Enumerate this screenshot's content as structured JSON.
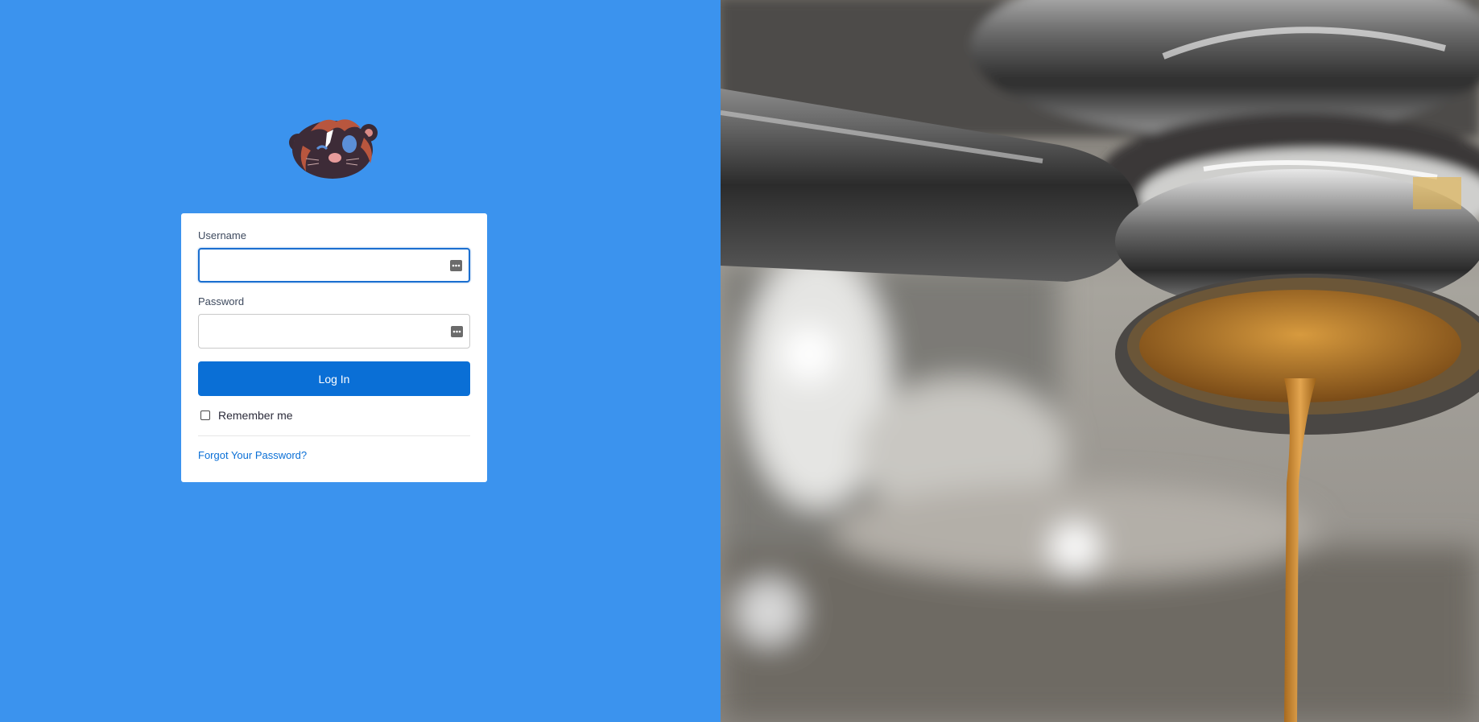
{
  "login": {
    "username_label": "Username",
    "username_value": "",
    "password_label": "Password",
    "password_value": "",
    "login_button": "Log In",
    "remember_me": "Remember me",
    "remember_checked": false,
    "forgot_password": "Forgot Your Password?"
  },
  "icons": {
    "logo": "hamster-mascot-logo",
    "field_icon": "password-manager-key-icon",
    "hero": "espresso-machine-photo"
  },
  "colors": {
    "left_background": "#3b93ee",
    "button": "#0a6fd6",
    "link": "#0a6fd6",
    "focus_border": "#1b6fd0"
  }
}
